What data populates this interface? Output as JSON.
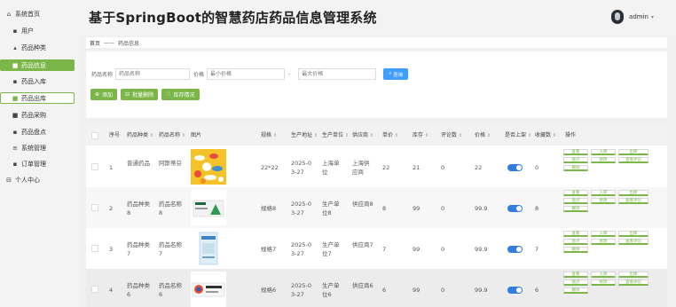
{
  "header": {
    "title": "基于SpringBoot的智慧药店药品信息管理系统",
    "user": "admin"
  },
  "sidebar": {
    "items": [
      {
        "label": "系统首页",
        "icon": "home-icon",
        "glyph": "⌂",
        "state": ""
      },
      {
        "label": "用户",
        "icon": "grid-icon",
        "glyph": "▪",
        "state": "sub"
      },
      {
        "label": "药品种类",
        "icon": "cap-icon",
        "glyph": "▴",
        "state": "sub"
      },
      {
        "label": "药品信息",
        "icon": "doc-icon",
        "glyph": "■",
        "state": "active"
      },
      {
        "label": "药品入库",
        "icon": "grid-icon",
        "glyph": "▪",
        "state": "sub"
      },
      {
        "label": "药品出库",
        "icon": "doc-icon",
        "glyph": "■",
        "state": "active hover"
      },
      {
        "label": "药品采购",
        "icon": "list-icon",
        "glyph": "■",
        "state": "sub"
      },
      {
        "label": "药品盘点",
        "icon": "grid-icon",
        "glyph": "▪",
        "state": "sub"
      },
      {
        "label": "系统管理",
        "icon": "list-icon",
        "glyph": "≡",
        "state": "sub"
      },
      {
        "label": "订单管理",
        "icon": "grid-icon",
        "glyph": "▪",
        "state": "sub"
      },
      {
        "label": "个人中心",
        "icon": "user-icon",
        "glyph": "⊟",
        "state": ""
      }
    ]
  },
  "breadcrumb": {
    "home": "首页",
    "sep": "——",
    "current": "药品信息"
  },
  "search": {
    "name_label": "药品名称",
    "name_placeholder": "药品名称",
    "price_label": "价格",
    "min_placeholder": "最小价格",
    "sep": "-",
    "max_placeholder": "最大价格",
    "button": "查询"
  },
  "actions": {
    "add": "添加",
    "batch_delete": "批量删除",
    "stock": "库存情况"
  },
  "table": {
    "columns": [
      "序号",
      "药品种类",
      "药品名称",
      "图片",
      "规格",
      "生产地址",
      "生产单位",
      "供应商",
      "单价",
      "库存",
      "评论数",
      "价格",
      "是否上架",
      "收藏数",
      "操作"
    ],
    "ops": [
      "查看",
      "入库",
      "出库",
      "盘点",
      "修改",
      "查看评论",
      "删除"
    ],
    "rows": [
      {
        "no": "1",
        "kind": "普通药品",
        "name": "阿斯蒂芬",
        "spec": "22*22",
        "addr": "2025-03-27",
        "unit": "上海单位",
        "supplier": "上海供应商",
        "unit_price": "22",
        "stock": "21",
        "comments": "0",
        "price": "22",
        "fav": "0",
        "img": "pills"
      },
      {
        "no": "2",
        "kind": "药品种类8",
        "name": "药品名称8",
        "spec": "规格8",
        "addr": "2025-03-27",
        "unit": "生产单位8",
        "supplier": "供应商8",
        "unit_price": "8",
        "stock": "99",
        "comments": "0",
        "price": "99.9",
        "fav": "8",
        "img": "box-green"
      },
      {
        "no": "3",
        "kind": "药品种类7",
        "name": "药品名称7",
        "spec": "规格7",
        "addr": "2025-03-27",
        "unit": "生产单位7",
        "supplier": "供应商7",
        "unit_price": "7",
        "stock": "99",
        "comments": "0",
        "price": "99.9",
        "fav": "7",
        "img": "box-blue"
      },
      {
        "no": "4",
        "kind": "药品种类6",
        "name": "药品名称6",
        "spec": "规格6",
        "addr": "2025-03-27",
        "unit": "生产单位6",
        "supplier": "供应商6",
        "unit_price": "6",
        "stock": "99",
        "comments": "0",
        "price": "99.9",
        "fav": "6",
        "img": "box-red"
      }
    ]
  },
  "colors": {
    "accent_green": "#7ab648",
    "primary_blue": "#409eff",
    "toggle_blue": "#2f7ee0"
  }
}
